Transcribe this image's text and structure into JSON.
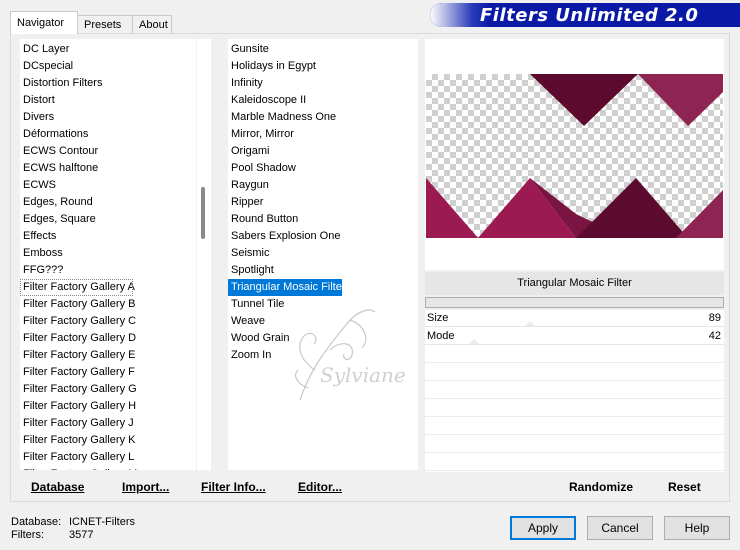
{
  "window": {
    "title": "Filters Unlimited 2.0"
  },
  "tabs": [
    {
      "label": "Navigator",
      "active": true
    },
    {
      "label": "Presets",
      "active": false
    },
    {
      "label": "About",
      "active": false
    }
  ],
  "categories": {
    "items": [
      "DC Layer",
      "DCspecial",
      "Distortion Filters",
      "Distort",
      "Divers",
      "Déformations",
      "ECWS Contour",
      "ECWS halftone",
      "ECWS",
      "Edges, Round",
      "Edges, Square",
      "Effects",
      "Emboss",
      "FFG???",
      "Filter Factory Gallery A",
      "Filter Factory Gallery B",
      "Filter Factory Gallery C",
      "Filter Factory Gallery D",
      "Filter Factory Gallery E",
      "Filter Factory Gallery F",
      "Filter Factory Gallery G",
      "Filter Factory Gallery H",
      "Filter Factory Gallery J",
      "Filter Factory Gallery K",
      "Filter Factory Gallery L",
      "Filter Factory Gallery M"
    ],
    "selected": "Filter Factory Gallery A"
  },
  "filters": {
    "items": [
      "Gunsite",
      "Holidays in Egypt",
      "Infinity",
      "Kaleidoscope II",
      "Marble Madness One",
      "Mirror, Mirror",
      "Origami",
      "Pool Shadow",
      "Raygun",
      "Ripper",
      "Round Button",
      "Sabers Explosion One",
      "Seismic",
      "Spotlight",
      "Triangular Mosaic Filter",
      "Tunnel Tile",
      "Weave",
      "Wood Grain",
      "Zoom In"
    ],
    "selected": "Triangular Mosaic Filter"
  },
  "preview": {
    "filter_name": "Triangular Mosaic Filter",
    "colors": {
      "dark": "#5c0a2e",
      "mid": "#7a1440",
      "light": "#8e2452",
      "bright": "#9c1a52"
    }
  },
  "parameters": [
    {
      "label": "Size",
      "value": "89",
      "level": 0.35
    },
    {
      "label": "Mode",
      "value": "42",
      "level": 0.165
    }
  ],
  "actions": {
    "database": "Database",
    "import": "Import...",
    "filter_info": "Filter Info...",
    "editor": "Editor...",
    "randomize": "Randomize",
    "reset": "Reset"
  },
  "status": {
    "database_label": "Database:",
    "database_value": "ICNET-Filters",
    "filters_label": "Filters:",
    "filters_value": "3577"
  },
  "buttons": {
    "apply": "Apply",
    "cancel": "Cancel",
    "help": "Help"
  },
  "watermark": {
    "text": "Sylviane"
  },
  "theme": {
    "banner": "#0a1aa6",
    "selection": "#0078d7"
  }
}
